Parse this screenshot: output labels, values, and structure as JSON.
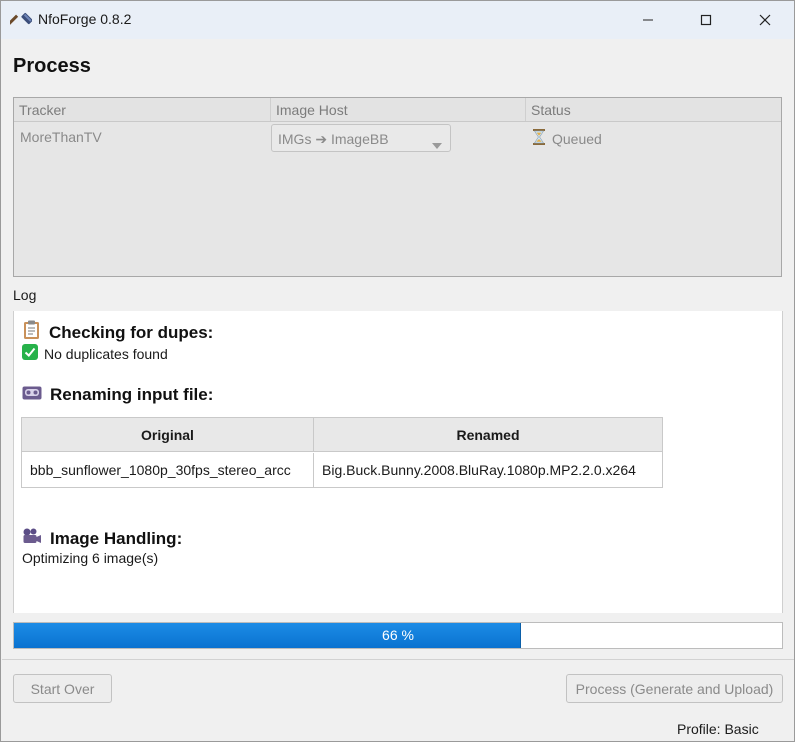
{
  "window": {
    "title": "NfoForge 0.8.2",
    "icons": {
      "app": "hammer-icon",
      "minimize": "minimize-icon",
      "maximize": "maximize-icon",
      "close": "close-icon"
    }
  },
  "page": {
    "title": "Process"
  },
  "tracker_table": {
    "headers": [
      "Tracker",
      "Image Host",
      "Status"
    ],
    "rows": [
      {
        "tracker": "MoreThanTV",
        "image_host": "IMGs ➔ ImageBB",
        "status": "Queued",
        "status_icon": "hourglass-icon"
      }
    ]
  },
  "log": {
    "label": "Log",
    "sections": [
      {
        "icon": "clipboard-icon",
        "heading": "Checking for dupes:"
      },
      {
        "icon": "videocassette-icon",
        "heading": "Renaming input file:"
      },
      {
        "icon": "camera-icon",
        "heading": "Image Handling:"
      }
    ],
    "dupes_result": {
      "icon": "check-mark-icon",
      "text": "No duplicates found"
    },
    "rename_table": {
      "headers": [
        "Original",
        "Renamed"
      ],
      "original": "bbb_sunflower_1080p_30fps_stereo_arcc",
      "renamed": "Big.Buck.Bunny.2008.BluRay.1080p.MP2.2.0.x264"
    },
    "image_status": "Optimizing 6 image(s)"
  },
  "progress": {
    "value": 66,
    "label": "66 %",
    "color": "#0a72d0"
  },
  "buttons": {
    "start_over": "Start Over",
    "process": "Process (Generate and Upload)"
  },
  "footer": {
    "profile": "Profile: Basic"
  }
}
